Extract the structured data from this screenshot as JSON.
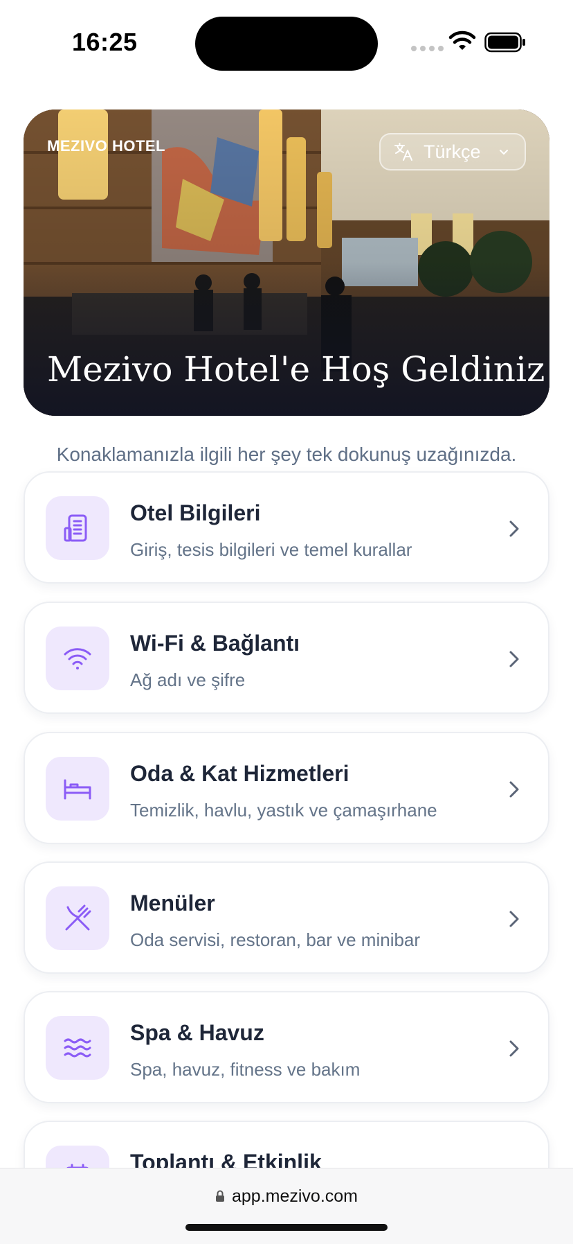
{
  "status_bar": {
    "time": "16:25"
  },
  "hero": {
    "brand": "MEZIVO HOTEL",
    "language": "Türkçe",
    "title": "Mezivo Hotel'e Hoş Geldiniz"
  },
  "subtitle": "Konaklamanızla ilgili her şey tek dokunuş uzağınızda.",
  "accent_color": "#8b5cf6",
  "cards": [
    {
      "icon": "hotel-info-icon",
      "title": "Otel Bilgileri",
      "desc": "Giriş, tesis bilgileri ve temel kurallar"
    },
    {
      "icon": "wifi-icon",
      "title": "Wi-Fi & Bağlantı",
      "desc": "Ağ adı ve şifre"
    },
    {
      "icon": "bed-icon",
      "title": "Oda & Kat Hizmetleri",
      "desc": "Temizlik, havlu, yastık ve çamaşırhane"
    },
    {
      "icon": "utensils-icon",
      "title": "Menüler",
      "desc": "Oda servisi, restoran, bar ve minibar"
    },
    {
      "icon": "waves-icon",
      "title": "Spa & Havuz",
      "desc": "Spa, havuz, fitness ve bakım"
    },
    {
      "icon": "calendar-icon",
      "title": "Toplantı & Etkinlik",
      "desc": ""
    }
  ],
  "browser": {
    "url": "app.mezivo.com"
  }
}
